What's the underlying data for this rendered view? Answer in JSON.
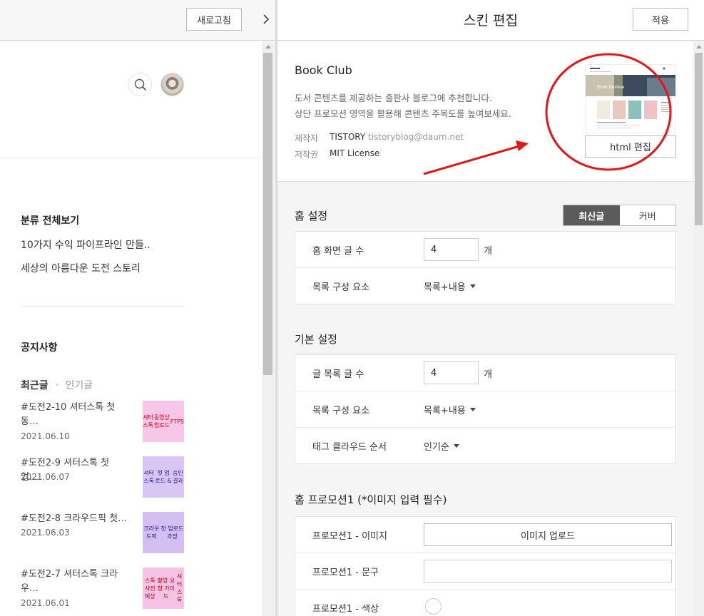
{
  "left": {
    "refresh_label": "새로고침",
    "collapse_icon": "chevron-right-icon",
    "category": {
      "title": "분류 전체보기",
      "items": [
        "10가지 수익 파이프라인 만들..",
        "세상의 아름다운 도전 스토리"
      ]
    },
    "notice_title": "공지사항",
    "tabs": {
      "active": "최근글",
      "inactive": "인기글"
    },
    "posts": [
      {
        "title": "#도전2-10 셔터스톡 첫 동…",
        "date": "2021.06.10",
        "thumb": "셔터스톡\n동영상 업로드\nFTP5",
        "bg": "#f7c6e8",
        "fg": "#d00000"
      },
      {
        "title": "#도전2-9 셔터스톡 첫 업…",
        "date": "2021.06.07",
        "thumb": "셔터스톡\n첫 업로드 &\n승인결과",
        "bg": "#d9c6f5",
        "fg": "#1a1a9a"
      },
      {
        "title": "#도전2-8 크라우드픽 첫…",
        "date": "2021.06.03",
        "thumb": "크라우드픽\n첫 업로드 과정",
        "bg": "#d4bff2",
        "fg": "#1a1a9a"
      },
      {
        "title": "#도전2-7 셔터스톡 크라우…",
        "date": "2021.06.01",
        "thumb": "스톡사진 예상\n촬영 요청 가이드\n셔터스톡",
        "bg": "#f6c3e6",
        "fg": "#c00000"
      }
    ]
  },
  "right": {
    "title": "스킨 편집",
    "apply_label": "적용",
    "skin": {
      "name": "Book Club",
      "desc_line1": "도서 콘텐츠를 제공하는 출판사 블로그에 추천합니다.",
      "desc_line2": "상단 프로모션 영역을 활용해 콘텐츠 주목도를 높여보세요.",
      "maker_label": "제작자",
      "maker_value": "TISTORY",
      "maker_email": "tistoryblog@daum.net",
      "license_label": "저작권",
      "license_value": "MIT License",
      "thumb_text": "Book Review",
      "html_edit_label": "html 편집"
    },
    "home_settings": {
      "title": "홈 설정",
      "seg_active": "최신글",
      "seg_inactive": "커버",
      "rows": [
        {
          "label": "홈 화면 글 수",
          "value": "4",
          "unit": "개"
        },
        {
          "label": "목록 구성 요소",
          "value": "목록+내용"
        }
      ]
    },
    "basic_settings": {
      "title": "기본 설정",
      "rows": [
        {
          "label": "글 목록 글 수",
          "value": "4",
          "unit": "개"
        },
        {
          "label": "목록 구성 요소",
          "value": "목록+내용"
        },
        {
          "label": "태그 클라우드 순서",
          "value": "인기순"
        }
      ]
    },
    "promotion1": {
      "title": "홈 프로모션1 (*이미지 입력 필수)",
      "rows": [
        {
          "label": "프로모션1 - 이미지",
          "button": "이미지 업로드"
        },
        {
          "label": "프로모션1 - 문구",
          "value": ""
        },
        {
          "label": "프로모션1 - 색상"
        }
      ]
    }
  },
  "annotation": {
    "color": "#e01818"
  }
}
